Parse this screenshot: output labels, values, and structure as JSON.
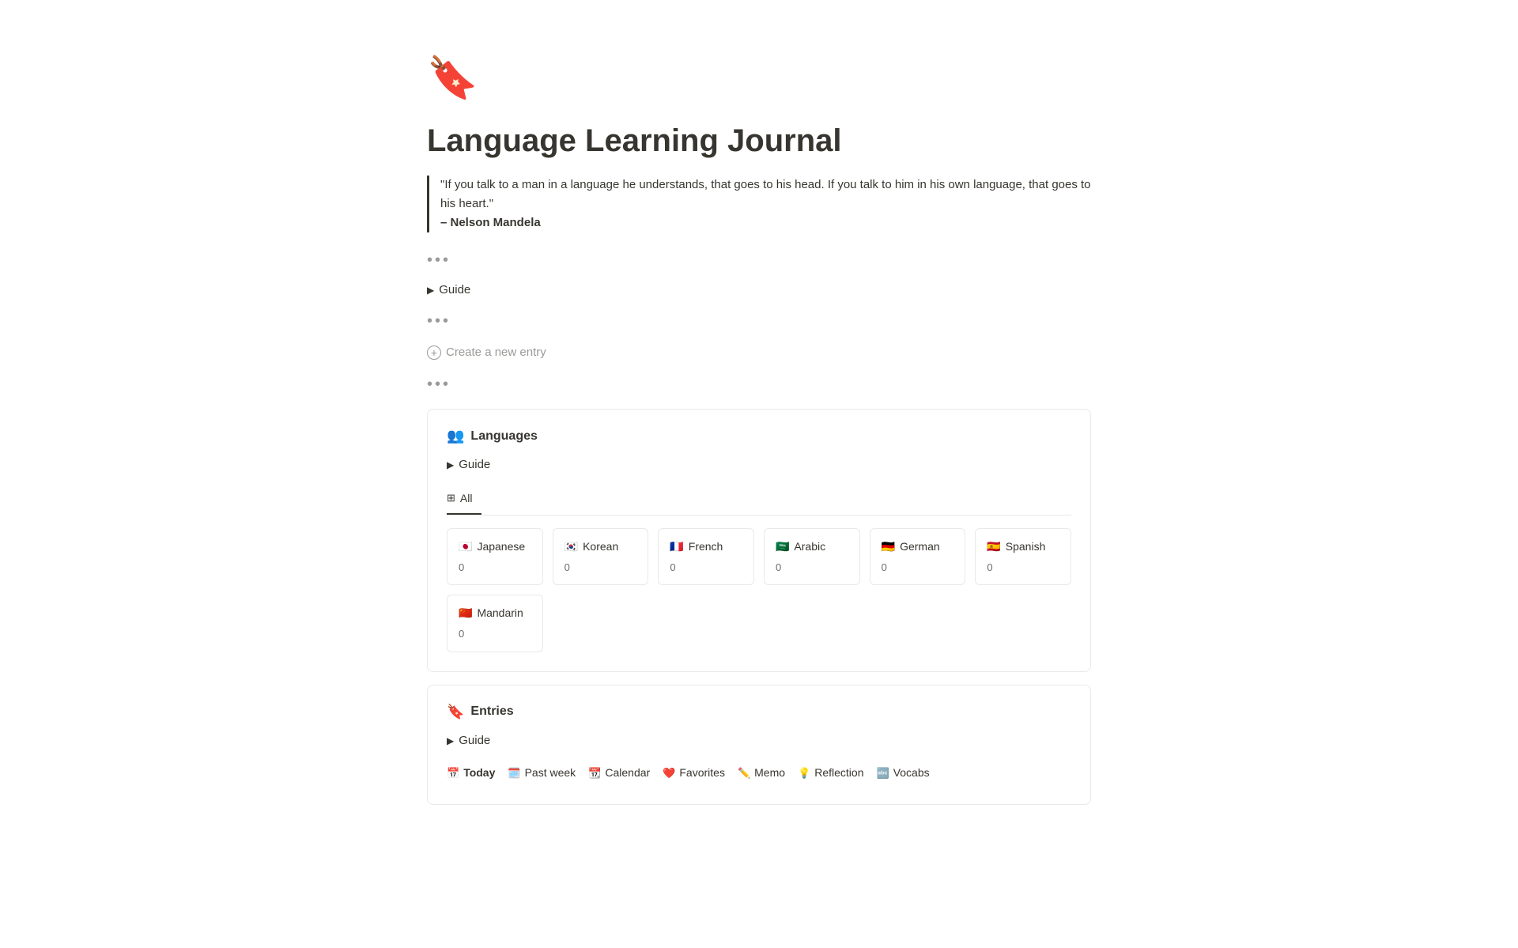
{
  "page": {
    "icon": "🔖",
    "title": "Language Learning Journal",
    "quote_text": "\"If you talk to a man in a language he understands, that goes to his head. If you talk to him in his own language, that goes to his heart.\"",
    "quote_author": "– Nelson Mandela",
    "dots1": "•••",
    "guide_toggle": "Guide",
    "dots2": "•••",
    "create_entry_label": "Create a new entry",
    "dots3": "•••"
  },
  "languages_section": {
    "icon": "👥",
    "title": "Languages",
    "guide_label": "Guide",
    "tab_all_icon": "⊞",
    "tab_all_label": "All",
    "languages": [
      {
        "flag": "🇯🇵",
        "name": "Japanese",
        "count": "0"
      },
      {
        "flag": "🇰🇷",
        "name": "Korean",
        "count": "0"
      },
      {
        "flag": "🇫🇷",
        "name": "French",
        "count": "0"
      },
      {
        "flag": "🇸🇦",
        "name": "Arabic",
        "count": "0"
      },
      {
        "flag": "🇩🇪",
        "name": "German",
        "count": "0"
      },
      {
        "flag": "🇪🇸",
        "name": "Spanish",
        "count": "0"
      },
      {
        "flag": "🇨🇳",
        "name": "Mandarin",
        "count": "0"
      }
    ]
  },
  "entries_section": {
    "icon": "🔖",
    "title": "Entries",
    "guide_label": "Guide",
    "tabs": [
      {
        "icon": "📅",
        "label": "Today",
        "active": true
      },
      {
        "icon": "🗓️",
        "label": "Past week",
        "active": false
      },
      {
        "icon": "📆",
        "label": "Calendar",
        "active": false
      },
      {
        "icon": "❤️",
        "label": "Favorites",
        "active": false
      },
      {
        "icon": "✏️",
        "label": "Memo",
        "active": false
      },
      {
        "icon": "💡",
        "label": "Reflection",
        "active": false
      },
      {
        "icon": "🔤",
        "label": "Vocabs",
        "active": false
      }
    ]
  }
}
